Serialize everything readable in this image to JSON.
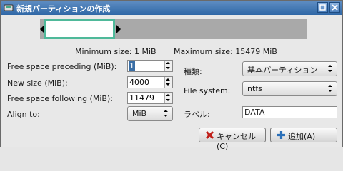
{
  "window": {
    "title": "新規パーティションの作成"
  },
  "graph": {
    "used_fraction": 0.27
  },
  "sizes": {
    "minimum": "Minimum size: 1 MiB",
    "maximum": "Maximum size: 15479 MiB"
  },
  "form": {
    "preceding": {
      "label": "Free space preceding (MiB):",
      "value": "1"
    },
    "new_size": {
      "label": "New size (MiB):",
      "value": "4000"
    },
    "following": {
      "label": "Free space following (MiB):",
      "value": "11479"
    },
    "align": {
      "label": "Align to:",
      "value": "MiB"
    },
    "type": {
      "label": "種類:",
      "value": "基本パーティション"
    },
    "filesystem": {
      "label": "File system:",
      "value": "ntfs"
    },
    "fslabel": {
      "label": "ラベル:",
      "value": "DATA"
    }
  },
  "buttons": {
    "cancel": "キャンセル(C)",
    "add": "追加(A)"
  },
  "colors": {
    "partition": "#4fb99a",
    "unallocated": "#a9a9a9",
    "titlebar": "#3a6ea5"
  },
  "icons": {
    "app": "disk-icon",
    "cancel": "x-icon",
    "add": "plus-icon"
  }
}
